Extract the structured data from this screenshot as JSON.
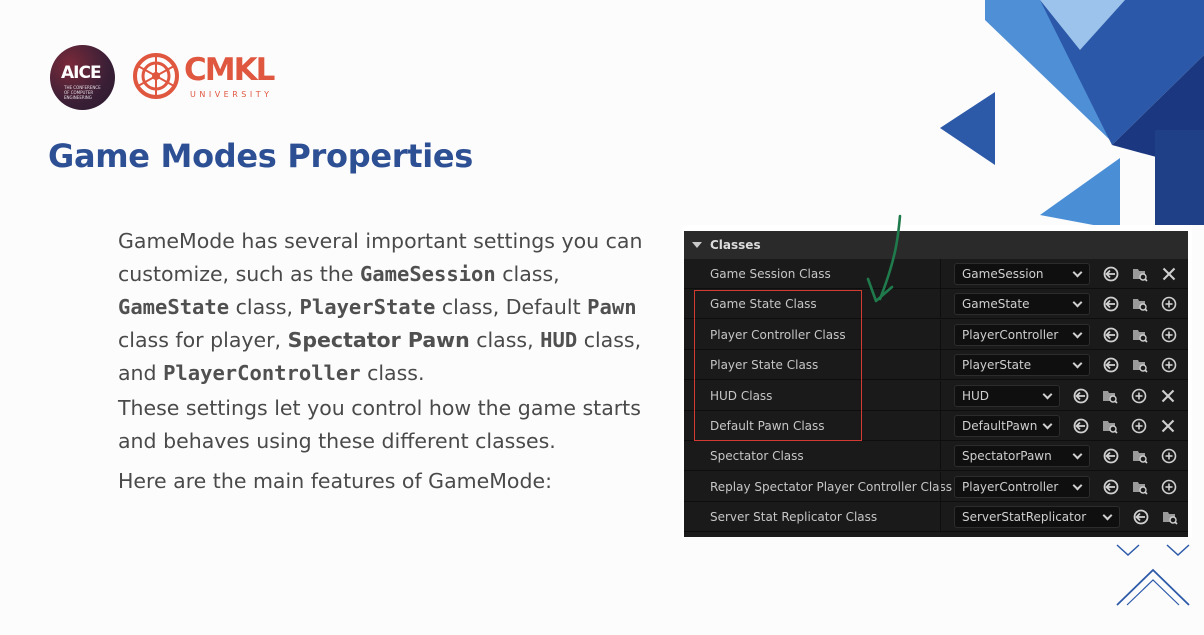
{
  "logos": {
    "aice": {
      "text": "AICE",
      "subtext": "THE CONFERENCE OF COMPUTER ENGINEERING"
    },
    "cmkl": {
      "text": "CMKL",
      "subtext": "UNIVERSITY"
    }
  },
  "title": {
    "regular": "Game Modes",
    "bold": "Properties"
  },
  "body": {
    "p1": [
      {
        "t": "GameMode has several important settings you can customize, such as the ",
        "s": "normal"
      },
      {
        "t": "GameSession",
        "s": "mono"
      },
      {
        "t": " class, ",
        "s": "normal"
      },
      {
        "t": "GameState",
        "s": "mono"
      },
      {
        "t": " class, ",
        "s": "normal"
      },
      {
        "t": "PlayerState",
        "s": "mono"
      },
      {
        "t": " class, Default ",
        "s": "normal"
      },
      {
        "t": "Pawn",
        "s": "mono"
      },
      {
        "t": " class for player, ",
        "s": "normal"
      },
      {
        "t": "Spectator Pawn",
        "s": "bold"
      },
      {
        "t": " class, ",
        "s": "normal"
      },
      {
        "t": "HUD",
        "s": "mono"
      },
      {
        "t": " class, and ",
        "s": "normal"
      },
      {
        "t": "PlayerController",
        "s": "mono"
      },
      {
        "t": " class.",
        "s": "normal"
      }
    ],
    "p2": "These settings let you control how the game starts and behaves using these different classes.",
    "p3": "Here are the main features of GameMode:"
  },
  "panel": {
    "section": "Classes",
    "rows": [
      {
        "label": "Game Session Class",
        "value": "GameSession",
        "icons": [
          "use-selected-icon",
          "browse-icon",
          "clear-icon"
        ]
      },
      {
        "label": "Game State Class",
        "value": "GameState",
        "icons": [
          "use-selected-icon",
          "browse-icon",
          "add-icon"
        ]
      },
      {
        "label": "Player Controller Class",
        "value": "PlayerController",
        "icons": [
          "use-selected-icon",
          "browse-icon",
          "add-icon"
        ]
      },
      {
        "label": "Player State Class",
        "value": "PlayerState",
        "icons": [
          "use-selected-icon",
          "browse-icon",
          "add-icon"
        ]
      },
      {
        "label": "HUD Class",
        "value": "HUD",
        "icons": [
          "use-selected-icon",
          "browse-icon",
          "add-icon",
          "clear-icon"
        ]
      },
      {
        "label": "Default Pawn Class",
        "value": "DefaultPawn",
        "icons": [
          "use-selected-icon",
          "browse-icon",
          "add-icon",
          "clear-icon"
        ]
      },
      {
        "label": "Spectator Class",
        "value": "SpectatorPawn",
        "icons": [
          "use-selected-icon",
          "browse-icon",
          "add-icon"
        ]
      },
      {
        "label": "Replay Spectator Player Controller Class",
        "value": "PlayerController",
        "icons": [
          "use-selected-icon",
          "browse-icon",
          "add-icon"
        ]
      },
      {
        "label": "Server Stat Replicator Class",
        "value": "ServerStatReplicator",
        "icons": [
          "use-selected-icon",
          "browse-icon"
        ]
      }
    ]
  },
  "colors": {
    "title": "#2d4f94",
    "highlight_box": "#d23a32",
    "arrow": "#1f7a4c",
    "deco_dark": "#1f3f86",
    "deco_light": "#4a8fd6"
  }
}
